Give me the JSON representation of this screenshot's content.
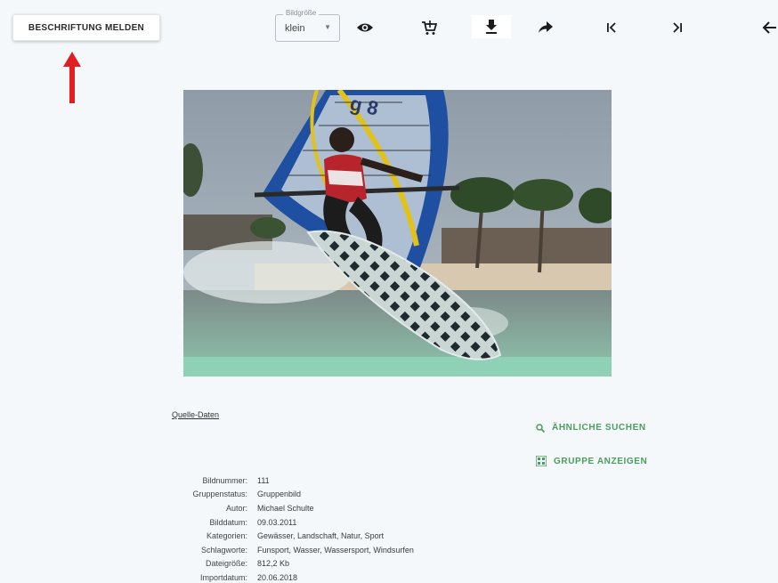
{
  "toolbar": {
    "report_label": "BESCHRIFTUNG MELDEN",
    "size_legend": "Bildgröße",
    "size_value": "klein",
    "icons": [
      "eye-icon",
      "cart-add-icon",
      "download-icon",
      "share-icon",
      "first-page-icon",
      "last-page-icon",
      "back-icon"
    ]
  },
  "colors": {
    "accent_green": "#4a9e5c",
    "arrow_red": "#e02020",
    "background": "#f4f8fb"
  },
  "main": {
    "source_link": "Quelle-Daten",
    "actions": {
      "similar_label": "ÄHNLICHE SUCHEN",
      "group_label": "GRUPPE ANZEIGEN"
    },
    "meta": [
      {
        "key": "Bildnummer:",
        "value": "111"
      },
      {
        "key": "Gruppenstatus:",
        "value": "Gruppenbild"
      },
      {
        "key": "Autor:",
        "value": "Michael Schulte"
      },
      {
        "key": "Bilddatum:",
        "value": "09.03.2011"
      },
      {
        "key": "Kategorien:",
        "value": "Gewässer, Landschaft, Natur, Sport"
      },
      {
        "key": "Schlagworte:",
        "value": "Funsport, Wasser, Wassersport, Windsurfen"
      },
      {
        "key": "Dateigröße:",
        "value": "812,2 Kb"
      },
      {
        "key": "Importdatum:",
        "value": "20.06.2018"
      }
    ]
  }
}
